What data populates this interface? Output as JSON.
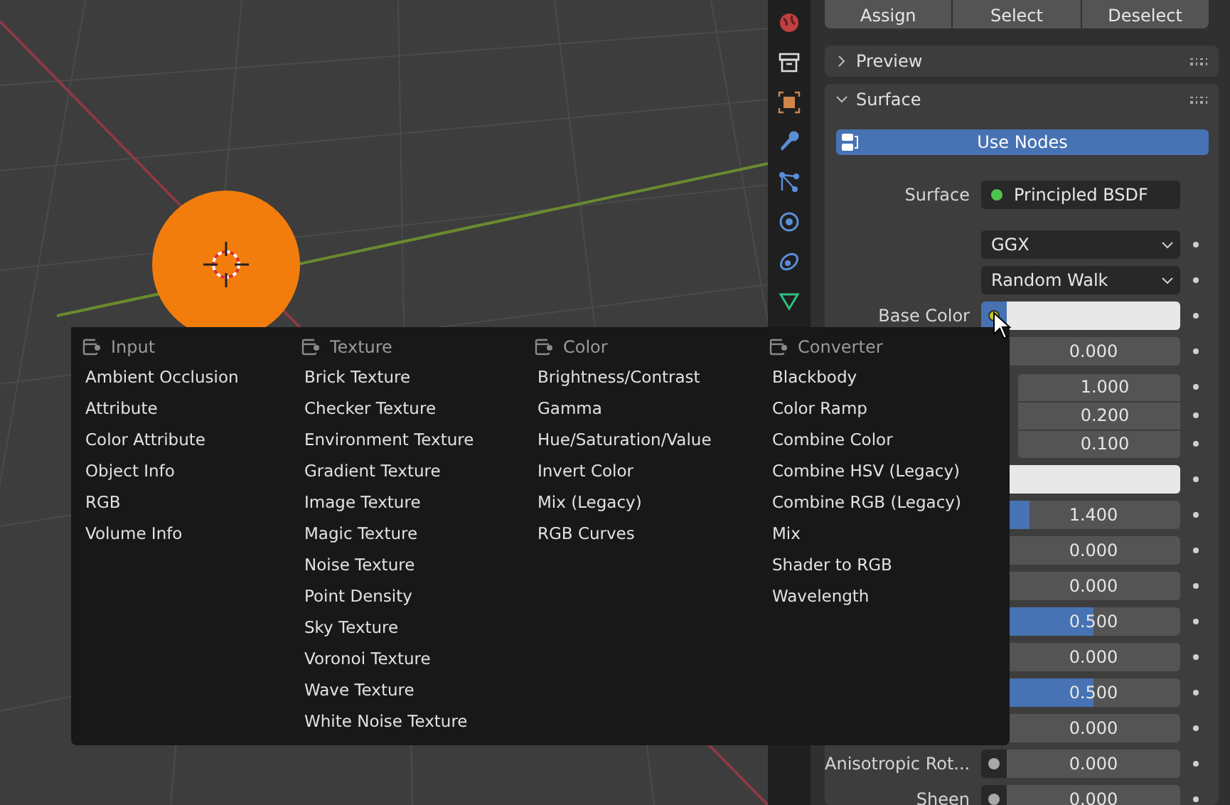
{
  "header_buttons": [
    "Assign",
    "Select",
    "Deselect"
  ],
  "panels": [
    {
      "title": "Preview",
      "expanded": false
    },
    {
      "title": "Surface",
      "expanded": true
    }
  ],
  "use_nodes": {
    "label": "Use Nodes",
    "on": true
  },
  "surface": {
    "label": "Surface",
    "value": "Principled BSDF"
  },
  "properties": [
    {
      "kind": "dropdown",
      "value": "GGX"
    },
    {
      "kind": "dropdown",
      "value": "Random Walk"
    },
    {
      "kind": "color",
      "label": "Base Color",
      "socket": true,
      "hovered": true
    },
    {
      "kind": "value",
      "value": "0.000"
    },
    {
      "kind": "group",
      "fields": [
        {
          "value": "1.000"
        },
        {
          "value": "0.200"
        },
        {
          "value": "0.100"
        }
      ]
    },
    {
      "kind": "color"
    },
    {
      "kind": "slider",
      "value": "1.400",
      "level": 0.13
    },
    {
      "kind": "value",
      "value": "0.000"
    },
    {
      "kind": "value",
      "value": "0.000"
    },
    {
      "kind": "slider",
      "value": "0.500",
      "level": 0.5
    },
    {
      "kind": "value",
      "value": "0.000"
    },
    {
      "kind": "slider",
      "value": "0.500",
      "level": 0.5
    },
    {
      "kind": "value",
      "value": "0.000"
    },
    {
      "kind": "value",
      "label": "Anisotropic Rot...",
      "socket": true,
      "hovered": false,
      "value": "0.000"
    },
    {
      "kind": "value",
      "label": "Sheen",
      "socket": true,
      "hovered": false,
      "value": "0.000"
    }
  ],
  "add_menu": {
    "columns": [
      {
        "title": "Input",
        "items": [
          "Ambient Occlusion",
          "Attribute",
          "Color Attribute",
          "Object Info",
          "RGB",
          "Volume Info"
        ]
      },
      {
        "title": "Texture",
        "items": [
          "Brick Texture",
          "Checker Texture",
          "Environment Texture",
          "Gradient Texture",
          "Image Texture",
          "Magic Texture",
          "Noise Texture",
          "Point Density",
          "Sky Texture",
          "Voronoi Texture",
          "Wave Texture",
          "White Noise Texture"
        ]
      },
      {
        "title": "Color",
        "items": [
          "Brightness/Contrast",
          "Gamma",
          "Hue/Saturation/Value",
          "Invert Color",
          "Mix (Legacy)",
          "RGB Curves"
        ]
      },
      {
        "title": "Converter",
        "items": [
          "Blackbody",
          "Color Ramp",
          "Combine Color",
          "Combine HSV (Legacy)",
          "Combine RGB (Legacy)",
          "Mix",
          "Shader to RGB",
          "Wavelength"
        ]
      }
    ]
  }
}
